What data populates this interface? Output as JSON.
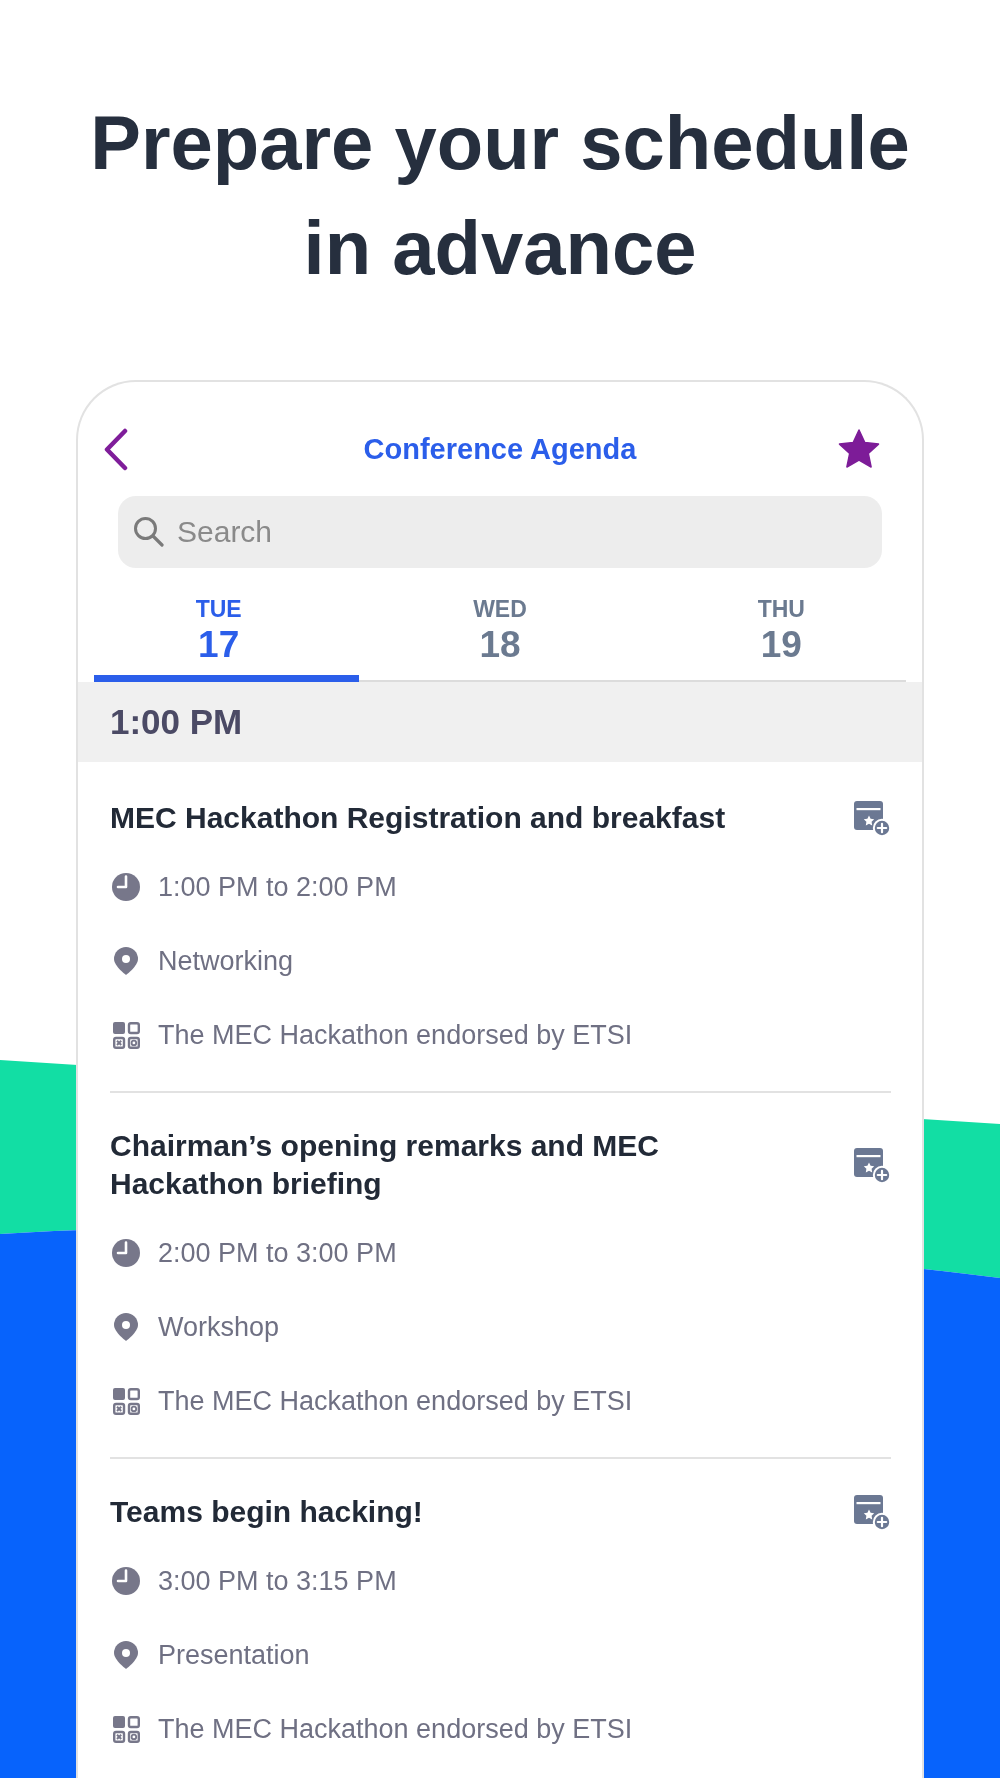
{
  "headline": "Prepare your schedule in advance",
  "app": {
    "title": "Conference Agenda",
    "search": {
      "placeholder": "Search"
    },
    "tabs": [
      {
        "weekday": "TUE",
        "day": "17",
        "selected": true
      },
      {
        "weekday": "WED",
        "day": "18",
        "selected": false
      },
      {
        "weekday": "THU",
        "day": "19",
        "selected": false
      }
    ],
    "time_header": "1:00 PM",
    "sessions": [
      {
        "title": "MEC Hackathon Registration and breakfast",
        "time": "1:00 PM to 2:00 PM",
        "location": "Networking",
        "track": "The MEC Hackathon endorsed by ETSI"
      },
      {
        "title": "Chairman’s opening remarks and MEC Hackathon briefing",
        "time": "2:00 PM to 3:00 PM",
        "location": "Workshop",
        "track": "The MEC Hackathon endorsed by ETSI"
      },
      {
        "title": "Teams begin hacking!",
        "time": "3:00 PM to 3:15 PM",
        "location": "Presentation",
        "track": "The MEC Hackathon endorsed by ETSI"
      }
    ]
  }
}
